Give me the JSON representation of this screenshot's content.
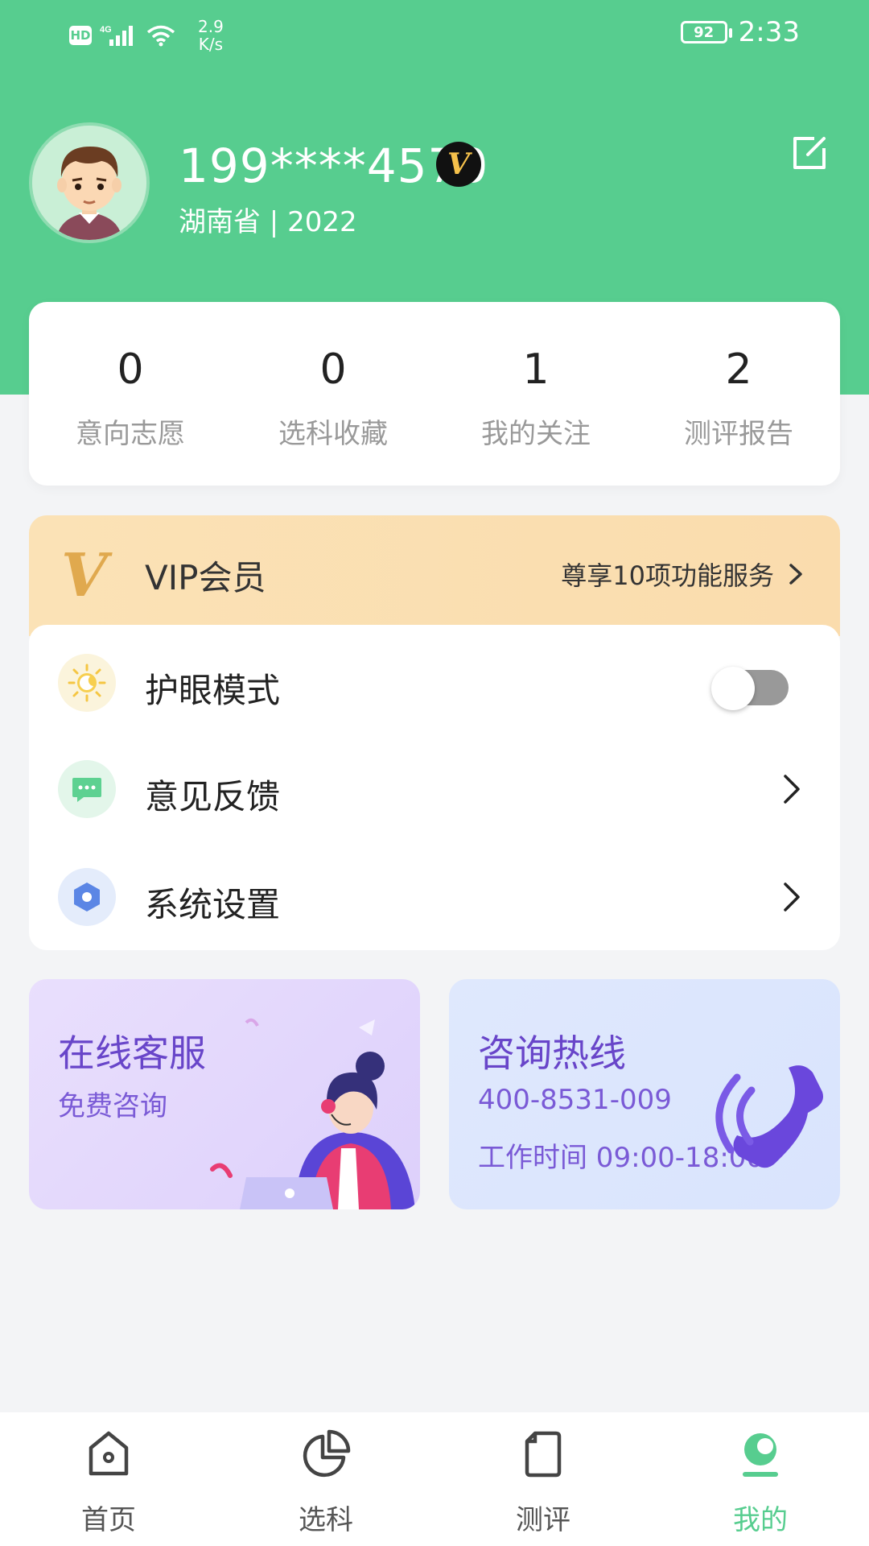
{
  "status_bar": {
    "hd": "HD",
    "network": "4G",
    "speed_value": "2.9",
    "speed_unit": "K/s",
    "battery": "92",
    "time": "2:33"
  },
  "profile": {
    "phone": "199****4570",
    "vip_badge": "V",
    "subtitle": "湖南省 | 2022"
  },
  "stats": [
    {
      "value": "0",
      "label": "意向志愿"
    },
    {
      "value": "0",
      "label": "选科收藏"
    },
    {
      "value": "1",
      "label": "我的关注"
    },
    {
      "value": "2",
      "label": "测评报告"
    }
  ],
  "vip": {
    "logo": "V",
    "title": "VIP会员",
    "desc": "尊享10项功能服务"
  },
  "menu": {
    "eye_mode": {
      "label": "护眼模式",
      "enabled": false
    },
    "feedback": {
      "label": "意见反馈"
    },
    "settings": {
      "label": "系统设置"
    }
  },
  "service": {
    "online": {
      "title": "在线客服",
      "sub": "免费咨询"
    },
    "hotline": {
      "title": "咨询热线",
      "phone": "400-8531-009",
      "hours": "工作时间 09:00-18:00"
    }
  },
  "nav": [
    {
      "label": "首页",
      "icon": "home-icon"
    },
    {
      "label": "选科",
      "icon": "pie-chart-icon"
    },
    {
      "label": "测评",
      "icon": "document-icon"
    },
    {
      "label": "我的",
      "icon": "profile-icon"
    }
  ],
  "colors": {
    "primary": "#57cd8f",
    "vip_gold": "#e0a94e",
    "service_purple": "#6845c9",
    "background": "#f3f4f6"
  }
}
